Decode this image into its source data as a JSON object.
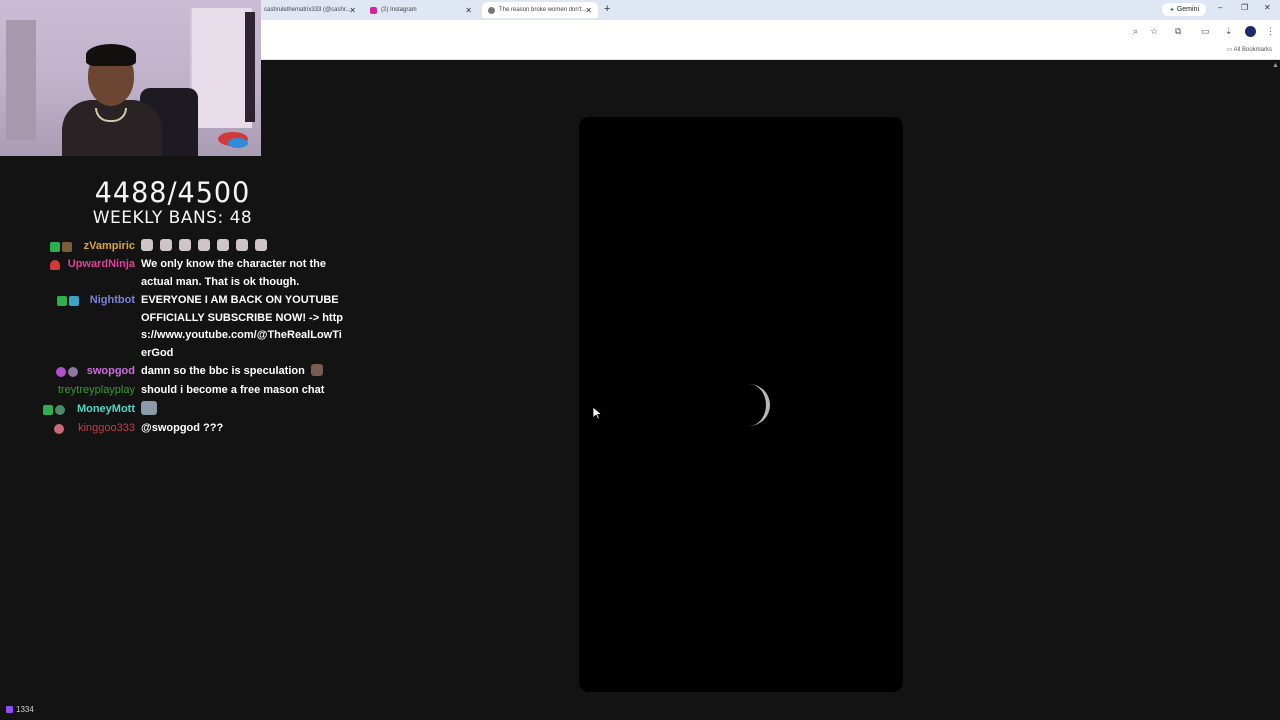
{
  "browser": {
    "tabs": [
      {
        "title": "cashrulethematrix333 (@cashr...",
        "active": false
      },
      {
        "title": "(2) Instagram",
        "active": false
      },
      {
        "title": "The reason broke women don't...",
        "active": true
      }
    ],
    "new_tab_icon": "plus-icon",
    "gemini_label": "Gemini",
    "all_bookmarks_label": "All Bookmarks"
  },
  "overlay": {
    "counter": "4488/4500",
    "weekly_bans": "WEEKLY BANS: 48"
  },
  "chat": [
    {
      "user": "zVampiric",
      "user_color": "#d8a43a",
      "text": "",
      "emotes": 7,
      "badge_colors": [
        "#2fae4e",
        "#7a5e3a"
      ]
    },
    {
      "user": "UpwardNinja",
      "user_color": "#e0409a",
      "text": "We only know the character not the actual man. That is ok though.",
      "badge_colors": [
        "#d23a3a"
      ]
    },
    {
      "user": "Nightbot",
      "user_color": "#7b83d6",
      "text": "EVERYONE I AM BACK ON YOUTUBE OFFICIALLY SUBSCRIBE NOW! -> https://www.youtube.com/@TheRealLowTierGod",
      "badge_colors": [
        "#2fae4e",
        "#3aa3c8"
      ]
    },
    {
      "user": "swopgod",
      "user_color": "#d16adf",
      "text": "damn so the bbc is speculation",
      "badge_colors": [
        "#b24fc9",
        "#8a7aa0"
      ]
    },
    {
      "user": "treytreyplayplay",
      "user_color": "#3a9a3a",
      "text": "should i become a free mason chat",
      "badge_colors": []
    },
    {
      "user": "MoneyMott",
      "user_color": "#4fd6c6",
      "text": "",
      "badge_colors": [
        "#2fae4e",
        "#4a8a6a"
      ]
    },
    {
      "user": "kinggoo333",
      "user_color": "#c73a4e",
      "text": "@swopgod ???",
      "badge_colors": [
        "#c96a7a"
      ]
    }
  ],
  "status": {
    "viewer_count": "1334"
  },
  "colors": {
    "page_bg": "#131313",
    "video_bg": "#000000"
  }
}
